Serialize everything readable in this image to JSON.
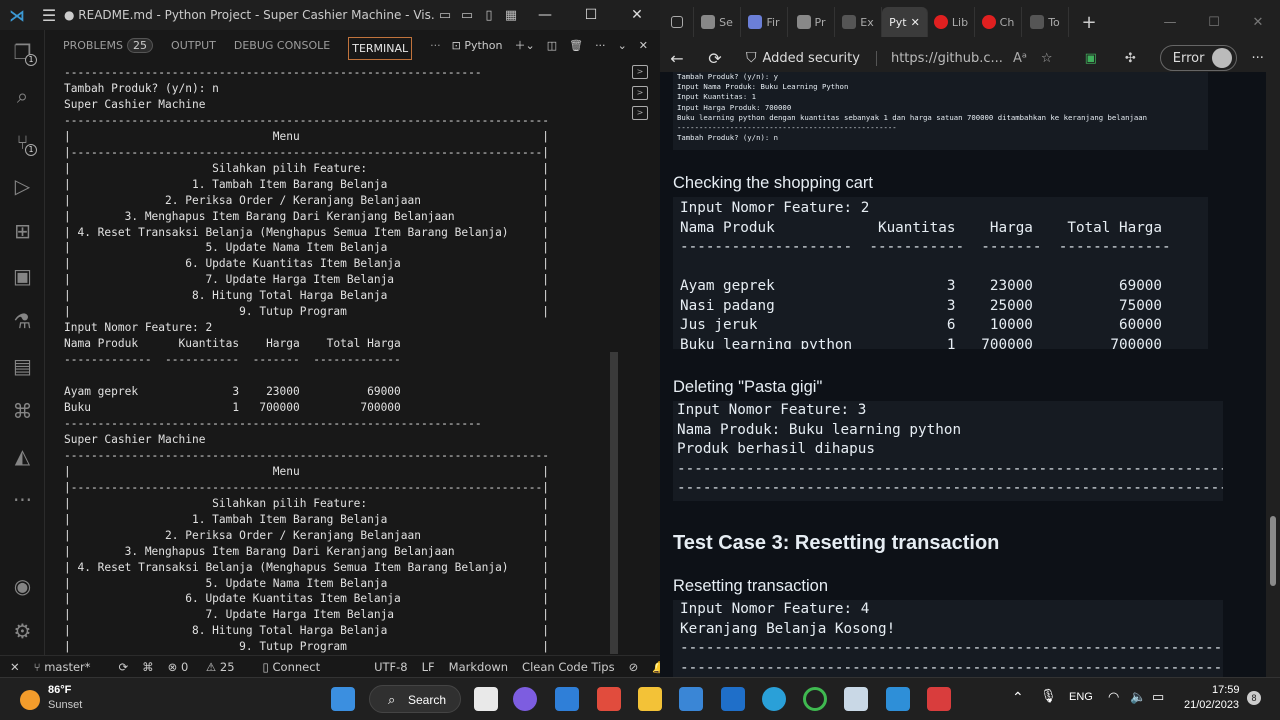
{
  "vscode": {
    "title": "● README.md - Python Project - Super Cashier Machine - Vis...",
    "tabs": {
      "problems": "PROBLEMS",
      "problems_count": "25",
      "output": "OUTPUT",
      "debug": "DEBUG CONSOLE",
      "terminal": "TERMINAL",
      "more": "···",
      "profile": "Python"
    },
    "activity_badges": {
      "explorer": "1",
      "scm": "1"
    },
    "terminal_lines": [
      "--------------------------------------------------------------",
      "Tambah Produk? (y/n): n",
      "Super Cashier Machine",
      "------------------------------------------------------------------------",
      "|                              Menu                                    |",
      "|----------------------------------------------------------------------|",
      "|                     Silahkan pilih Feature:                          |",
      "|                  1. Tambah Item Barang Belanja                       |",
      "|              2. Periksa Order / Keranjang Belanjaan                  |",
      "|        3. Menghapus Item Barang Dari Keranjang Belanjaan             |",
      "| 4. Reset Transaksi Belanja (Menghapus Semua Item Barang Belanja)     |",
      "|                    5. Update Nama Item Belanja                       |",
      "|                 6. Update Kuantitas Item Belanja                     |",
      "|                    7. Update Harga Item Belanja                      |",
      "|                  8. Hitung Total Harga Belanja                       |",
      "|                         9. Tutup Program                             |",
      "Input Nomor Feature: 2",
      "Nama Produk      Kuantitas    Harga    Total Harga",
      "-------------  -----------  -------  -------------",
      "",
      "Ayam geprek              3    23000          69000",
      "Buku                     1   700000         700000",
      "--------------------------------------------------------------",
      "Super Cashier Machine",
      "------------------------------------------------------------------------",
      "|                              Menu                                    |",
      "|----------------------------------------------------------------------|",
      "|                     Silahkan pilih Feature:                          |",
      "|                  1. Tambah Item Barang Belanja                       |",
      "|              2. Periksa Order / Keranjang Belanjaan                  |",
      "|        3. Menghapus Item Barang Dari Keranjang Belanjaan             |",
      "| 4. Reset Transaksi Belanja (Menghapus Semua Item Barang Belanja)     |",
      "|                    5. Update Nama Item Belanja                       |",
      "|                 6. Update Kuantitas Item Belanja                     |",
      "|                    7. Update Harga Item Belanja                      |",
      "|                  8. Hitung Total Harga Belanja                       |",
      "|                         9. Tutup Program                             |",
      "Input Nomor Feature: █"
    ],
    "status": {
      "branch": "master*",
      "errors": "0",
      "warnings": "25",
      "connect": "Connect",
      "encoding": "UTF-8",
      "eol": "LF",
      "language": "Markdown",
      "tips": "Clean Code Tips"
    }
  },
  "browser": {
    "tabs": [
      "Se",
      "Fir",
      "Pr",
      "Ex",
      "Pyt",
      "Lib",
      "Ch",
      "To"
    ],
    "security": "Added security",
    "url": "https://github.c...",
    "error_label": "Error",
    "top_snippet": [
      "Tambah Produk? (y/n): y",
      "Input Nama Produk: Buku Learning Python",
      "Input Kuantitas: 1",
      "Input Harga Produk: 700000",
      "Buku learning python dengan kuantitas sebanyak 1 dan harga satuan 700000 ditambahkan ke keranjang belanjaan",
      "--------------------------------------------------",
      "Tambah Produk? (y/n): n"
    ],
    "heading_cart": "Checking the shopping cart",
    "cart_block": [
      "Input Nomor Feature: 2",
      "Nama Produk            Kuantitas    Harga    Total Harga",
      "--------------------  -----------  -------  -------------",
      "",
      "Ayam geprek                    3    23000          69000",
      "Nasi padang                    3    25000          75000",
      "Jus jeruk                      6    10000          60000",
      "Buku learning python           1   700000         700000",
      "------------------------------------------------------------"
    ],
    "heading_delete": "Deleting \"Pasta gigi\"",
    "delete_block": [
      "Input Nomor Feature: 3",
      "Nama Produk: Buku learning python",
      "Produk berhasil dihapus",
      "------------------------------------------------------------------------",
      "------------------------------------------------------------------------"
    ],
    "heading_testcase": "Test Case 3: Resetting transaction",
    "heading_reset": "Resetting transaction",
    "reset_block": [
      "Input Nomor Feature: 4",
      "Keranjang Belanja Kosong!",
      "------------------------------------------------------------------------",
      "------------------------------------------------------------------------"
    ]
  },
  "taskbar": {
    "weather_temp": "86°F",
    "weather_desc": "Sunset",
    "search": "Search",
    "lang": "ENG",
    "time": "17:59",
    "date": "21/02/2023",
    "notif": "8"
  }
}
